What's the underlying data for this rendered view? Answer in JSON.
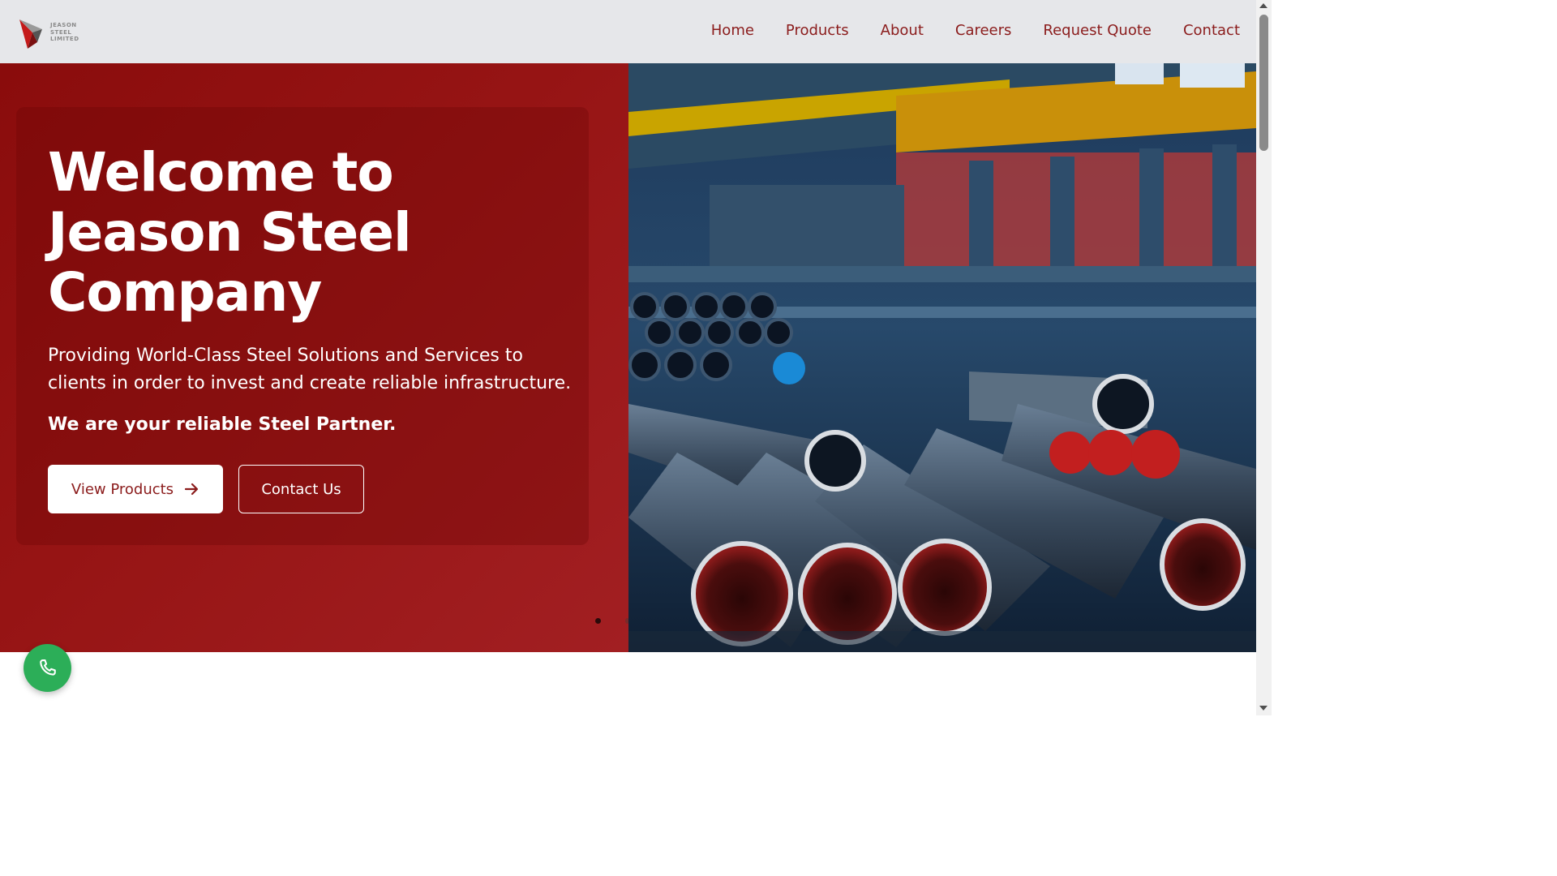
{
  "brand": {
    "logo_lines": [
      "JEASON",
      "STEEL",
      "LIMITED"
    ]
  },
  "nav": {
    "items": [
      {
        "label": "Home"
      },
      {
        "label": "Products"
      },
      {
        "label": "About"
      },
      {
        "label": "Careers"
      },
      {
        "label": "Request Quote"
      },
      {
        "label": "Contact"
      }
    ]
  },
  "hero": {
    "title_lines": [
      "Welcome to",
      "Jeason Steel",
      "Company"
    ],
    "subtitle": "Providing World-Class Steel Solutions and Services to clients in order to invest and create reliable infrastructure.",
    "tagline": "We are your reliable Steel Partner.",
    "primary_button": "View Products",
    "secondary_button": "Contact Us",
    "image_subject": "steel pipes warehouse"
  },
  "icons": {
    "arrow": "arrow-right-icon",
    "phone": "phone-icon",
    "logo": "jeason-logo-icon"
  },
  "colors": {
    "brand_red": "#8b1c1c",
    "header_bg": "#e6e7ea",
    "call_green": "#2cae58"
  }
}
